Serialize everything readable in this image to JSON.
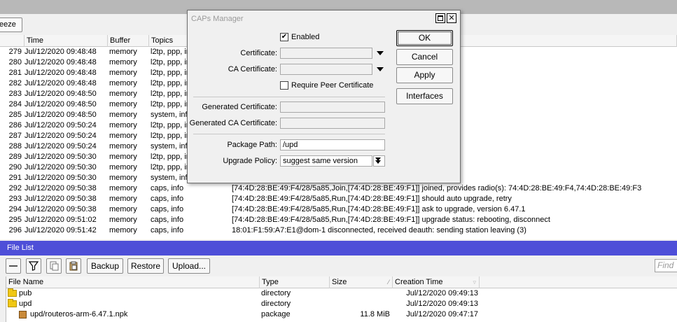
{
  "log_window": {
    "toolbar": {
      "freeze_label": "eeze"
    },
    "columns": [
      "Time",
      "Buffer",
      "Topics"
    ],
    "rows": [
      {
        "num": "279",
        "time": "Jul/12/2020 09:48:48",
        "buffer": "memory",
        "topics": "l2tp, ppp, info",
        "message": ""
      },
      {
        "num": "280",
        "time": "Jul/12/2020 09:48:48",
        "buffer": "memory",
        "topics": "l2tp, ppp, info",
        "message": ""
      },
      {
        "num": "281",
        "time": "Jul/12/2020 09:48:48",
        "buffer": "memory",
        "topics": "l2tp, ppp, info",
        "message": ""
      },
      {
        "num": "282",
        "time": "Jul/12/2020 09:48:48",
        "buffer": "memory",
        "topics": "l2tp, ppp, info",
        "message": ""
      },
      {
        "num": "283",
        "time": "Jul/12/2020 09:48:50",
        "buffer": "memory",
        "topics": "l2tp, ppp, info",
        "message": ""
      },
      {
        "num": "284",
        "time": "Jul/12/2020 09:48:50",
        "buffer": "memory",
        "topics": "l2tp, ppp, info",
        "message": ""
      },
      {
        "num": "285",
        "time": "Jul/12/2020 09:48:50",
        "buffer": "memory",
        "topics": "system, info",
        "message": ""
      },
      {
        "num": "286",
        "time": "Jul/12/2020 09:50:24",
        "buffer": "memory",
        "topics": "l2tp, ppp, info",
        "message": ""
      },
      {
        "num": "287",
        "time": "Jul/12/2020 09:50:24",
        "buffer": "memory",
        "topics": "l2tp, ppp, info",
        "message": ""
      },
      {
        "num": "288",
        "time": "Jul/12/2020 09:50:24",
        "buffer": "memory",
        "topics": "system, info",
        "message": ""
      },
      {
        "num": "289",
        "time": "Jul/12/2020 09:50:30",
        "buffer": "memory",
        "topics": "l2tp, ppp, info",
        "message": ""
      },
      {
        "num": "290",
        "time": "Jul/12/2020 09:50:30",
        "buffer": "memory",
        "topics": "l2tp, ppp, info",
        "message": ""
      },
      {
        "num": "291",
        "time": "Jul/12/2020 09:50:30",
        "buffer": "memory",
        "topics": "system, info",
        "message": ""
      },
      {
        "num": "292",
        "time": "Jul/12/2020 09:50:38",
        "buffer": "memory",
        "topics": "caps, info",
        "message": "[74:4D:28:BE:49:F4/28/5a85,Join,[74:4D:28:BE:49:F1]] joined, provides radio(s): 74:4D:28:BE:49:F4,74:4D:28:BE:49:F3"
      },
      {
        "num": "293",
        "time": "Jul/12/2020 09:50:38",
        "buffer": "memory",
        "topics": "caps, info",
        "message": "[74:4D:28:BE:49:F4/28/5a85,Run,[74:4D:28:BE:49:F1]] should auto upgrade, retry"
      },
      {
        "num": "294",
        "time": "Jul/12/2020 09:50:38",
        "buffer": "memory",
        "topics": "caps, info",
        "message": "[74:4D:28:BE:49:F4/28/5a85,Run,[74:4D:28:BE:49:F1]] ask to upgrade, version 6.47.1"
      },
      {
        "num": "295",
        "time": "Jul/12/2020 09:51:02",
        "buffer": "memory",
        "topics": "caps, info",
        "message": "[74:4D:28:BE:49:F4/28/5a85,Run,[74:4D:28:BE:49:F1]] upgrade status: rebooting, disconnect"
      },
      {
        "num": "296",
        "time": "Jul/12/2020 09:51:42",
        "buffer": "memory",
        "topics": "caps, info",
        "message": "18:01:F1:59:A7:E1@dom-1 disconnected, received deauth: sending station leaving (3)"
      }
    ]
  },
  "caps_dialog": {
    "title": "CAPs Manager",
    "enabled_label": "Enabled",
    "enabled_checked": true,
    "certificate_label": "Certificate:",
    "certificate_value": "",
    "ca_certificate_label": "CA Certificate:",
    "ca_certificate_value": "",
    "require_peer_label": "Require Peer Certificate",
    "require_peer_checked": false,
    "generated_cert_label": "Generated Certificate:",
    "generated_cert_value": "",
    "generated_ca_label": "Generated CA Certificate:",
    "generated_ca_value": "",
    "package_path_label": "Package Path:",
    "package_path_value": "/upd",
    "upgrade_policy_label": "Upgrade Policy:",
    "upgrade_policy_value": "suggest same version",
    "buttons": {
      "ok": "OK",
      "cancel": "Cancel",
      "apply": "Apply",
      "interfaces": "Interfaces"
    }
  },
  "file_list": {
    "title": "File List",
    "toolbar": {
      "backup": "Backup",
      "restore": "Restore",
      "upload": "Upload...",
      "find_placeholder": "Find"
    },
    "columns": {
      "name": "File Name",
      "type": "Type",
      "size": "Size",
      "created": "Creation Time"
    },
    "rows": [
      {
        "name": "pub",
        "type": "directory",
        "size": "",
        "created": "Jul/12/2020 09:49:13",
        "icon": "folder-icon"
      },
      {
        "name": "upd",
        "type": "directory",
        "size": "",
        "created": "Jul/12/2020 09:49:13",
        "icon": "folder-icon"
      },
      {
        "name": "upd/routeros-arm-6.47.1.npk",
        "type": "package",
        "size": "11.8 MiB",
        "created": "Jul/12/2020 09:47:17",
        "icon": "package-icon"
      }
    ]
  }
}
